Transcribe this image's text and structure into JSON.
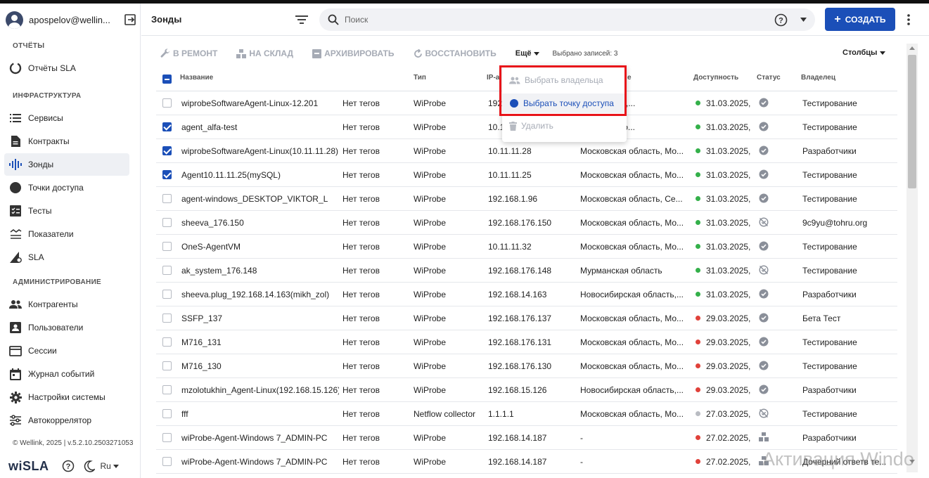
{
  "sidebar": {
    "username": "apospelov@wellin...",
    "sections": [
      {
        "title": "ОТЧЁТЫ"
      },
      {
        "title": "ИНФРАСТРУКТУРА"
      },
      {
        "title": "АДМИНИСТРИРОВАНИЕ"
      }
    ],
    "items": [
      {
        "label": "Отчёты SLA",
        "icon": "sla-report-icon"
      },
      {
        "label": "Сервисы",
        "icon": "list-icon"
      },
      {
        "label": "Контракты",
        "icon": "document-icon"
      },
      {
        "label": "Зонды",
        "icon": "waves-icon",
        "active": true
      },
      {
        "label": "Точки доступа",
        "icon": "access-point-icon"
      },
      {
        "label": "Тесты",
        "icon": "checklist-icon"
      },
      {
        "label": "Показатели",
        "icon": "metrics-icon"
      },
      {
        "label": "SLA",
        "icon": "sla-icon"
      },
      {
        "label": "Контрагенты",
        "icon": "people-icon"
      },
      {
        "label": "Пользователи",
        "icon": "user-card-icon"
      },
      {
        "label": "Сессии",
        "icon": "sessions-icon"
      },
      {
        "label": "Журнал событий",
        "icon": "calendar-icon"
      },
      {
        "label": "Настройки системы",
        "icon": "gear-icon"
      },
      {
        "label": "Автокоррелятор",
        "icon": "sliders-icon"
      }
    ],
    "copyright": "© Wellink, 2025 | v.5.2.10.2503271053",
    "logo": "wiSLA",
    "language": "Ru"
  },
  "header": {
    "title": "Зонды",
    "search_placeholder": "Поиск",
    "create_label": "СОЗДАТЬ"
  },
  "toolbar": {
    "repair": "В РЕМОНТ",
    "warehouse": "НА СКЛАД",
    "archive": "АРХИВИРОВАТЬ",
    "restore": "ВОССТАНОВИТЬ",
    "more": "Ещё",
    "selected": "Выбрано записей: 3",
    "columns": "Столбцы"
  },
  "menu": {
    "items": [
      {
        "label": "Выбрать владельца",
        "state": "disabled"
      },
      {
        "label": "Выбрать точку доступа",
        "state": "active"
      },
      {
        "label": "Удалить",
        "state": "disabled"
      }
    ]
  },
  "table": {
    "headers": [
      "Название",
      "Тип",
      "IP-а",
      "е",
      "Доступность",
      "Статус",
      "Владелец"
    ],
    "rows": [
      {
        "name": "wiprobeSoftwareAgent-Linux-12.201",
        "tags": "Нет тегов",
        "type": "WiProbe",
        "ip": "192",
        "region": "Республика,...",
        "avail_color": "#34b04a",
        "avail": "31.03.2025,",
        "status": "check",
        "owner": "Тестирование",
        "checked": false
      },
      {
        "name": "agent_alfa-test",
        "tags": "Нет тегов",
        "type": "WiProbe",
        "ip": "10.1",
        "region": "область, Мо...",
        "avail_color": "#34b04a",
        "avail": "31.03.2025,",
        "status": "check",
        "owner": "Тестирование",
        "checked": true
      },
      {
        "name": "wiprobeSoftwareAgent-Linux(10.11.11.28)",
        "tags": "Нет тегов",
        "type": "WiProbe",
        "ip": "10.11.11.28",
        "region": "Московская область, Мо...",
        "avail_color": "#34b04a",
        "avail": "31.03.2025,",
        "status": "check",
        "owner": "Разработчики",
        "checked": true
      },
      {
        "name": "Agent10.11.11.25(mySQL)",
        "tags": "Нет тегов",
        "type": "WiProbe",
        "ip": "10.11.11.25",
        "region": "Московская область, Мо...",
        "avail_color": "#34b04a",
        "avail": "31.03.2025,",
        "status": "check",
        "owner": "Тестирование",
        "checked": true
      },
      {
        "name": "agent-windows_DESKTOP_VIKTOR_L",
        "tags": "Нет тегов",
        "type": "WiProbe",
        "ip": "192.168.1.96",
        "region": "Московская область, Се...",
        "avail_color": "#34b04a",
        "avail": "31.03.2025,",
        "status": "check",
        "owner": "Тестирование",
        "checked": false
      },
      {
        "name": "sheeva_176.150",
        "tags": "Нет тегов",
        "type": "WiProbe",
        "ip": "192.168.176.150",
        "region": "Московская область, Мо...",
        "avail_color": "#34b04a",
        "avail": "31.03.2025,",
        "status": "off",
        "owner": "9c9yu@tohru.org",
        "checked": false
      },
      {
        "name": "OneS-AgentVM",
        "tags": "Нет тегов",
        "type": "WiProbe",
        "ip": "10.11.11.32",
        "region": "Московская область, Мо...",
        "avail_color": "#34b04a",
        "avail": "31.03.2025,",
        "status": "check",
        "owner": "Тестирование",
        "checked": false
      },
      {
        "name": "ak_system_176.148",
        "tags": "Нет тегов",
        "type": "WiProbe",
        "ip": "192.168.176.148",
        "region": "Мурманская область",
        "avail_color": "#34b04a",
        "avail": "31.03.2025,",
        "status": "off",
        "owner": "Тестирование",
        "checked": false
      },
      {
        "name": "sheeva.plug_192.168.14.163(mikh_zol)",
        "tags": "Нет тегов",
        "type": "WiProbe",
        "ip": "192.168.14.163",
        "region": "Новосибирская область,...",
        "avail_color": "#34b04a",
        "avail": "31.03.2025,",
        "status": "check",
        "owner": "Разработчики",
        "checked": false
      },
      {
        "name": "SSFP_137",
        "tags": "Нет тегов",
        "type": "WiProbe",
        "ip": "192.168.176.137",
        "region": "Московская область, Мо...",
        "avail_color": "#e0413a",
        "avail": "29.03.2025,",
        "status": "check",
        "owner": "Бета Тест",
        "checked": false
      },
      {
        "name": "M716_131",
        "tags": "Нет тегов",
        "type": "WiProbe",
        "ip": "192.168.176.131",
        "region": "Московская область, Мо...",
        "avail_color": "#e0413a",
        "avail": "29.03.2025,",
        "status": "check",
        "owner": "Тестирование",
        "checked": false
      },
      {
        "name": "M716_130",
        "tags": "Нет тегов",
        "type": "WiProbe",
        "ip": "192.168.176.130",
        "region": "Московская область, Мо...",
        "avail_color": "#e0413a",
        "avail": "29.03.2025,",
        "status": "check",
        "owner": "Тестирование",
        "checked": false
      },
      {
        "name": "mzolotukhin_Agent-Linux(192.168.15.126)",
        "tags": "Нет тегов",
        "type": "WiProbe",
        "ip": "192.168.15.126",
        "region": "Новосибирская область,...",
        "avail_color": "#e0413a",
        "avail": "29.03.2025,",
        "status": "check",
        "owner": "Разработчики",
        "checked": false
      },
      {
        "name": "fff",
        "tags": "Нет тегов",
        "type": "Netflow collector",
        "ip": "1.1.1.1",
        "region": "Московская область, Мо...",
        "avail_color": "#b9bcc2",
        "avail": "27.03.2025,",
        "status": "off",
        "owner": "Тестирование",
        "checked": false
      },
      {
        "name": "wiProbe-Agent-Windows 7_ADMIN-PC",
        "tags": "Нет тегов",
        "type": "WiProbe",
        "ip": "192.168.14.187",
        "region": "-",
        "avail_color": "#e0413a",
        "avail": "27.02.2025,",
        "status": "warehouse",
        "owner": "Разработчики",
        "checked": false
      },
      {
        "name": "wiProbe-Agent-Windows 7_ADMIN-PC",
        "tags": "Нет тегов",
        "type": "WiProbe",
        "ip": "192.168.14.187",
        "region": "-",
        "avail_color": "#e0413a",
        "avail": "27.02.2025,",
        "status": "warehouse",
        "owner": "Дочерний ответв те...",
        "checked": false
      }
    ]
  },
  "watermark": "Активация Windo"
}
